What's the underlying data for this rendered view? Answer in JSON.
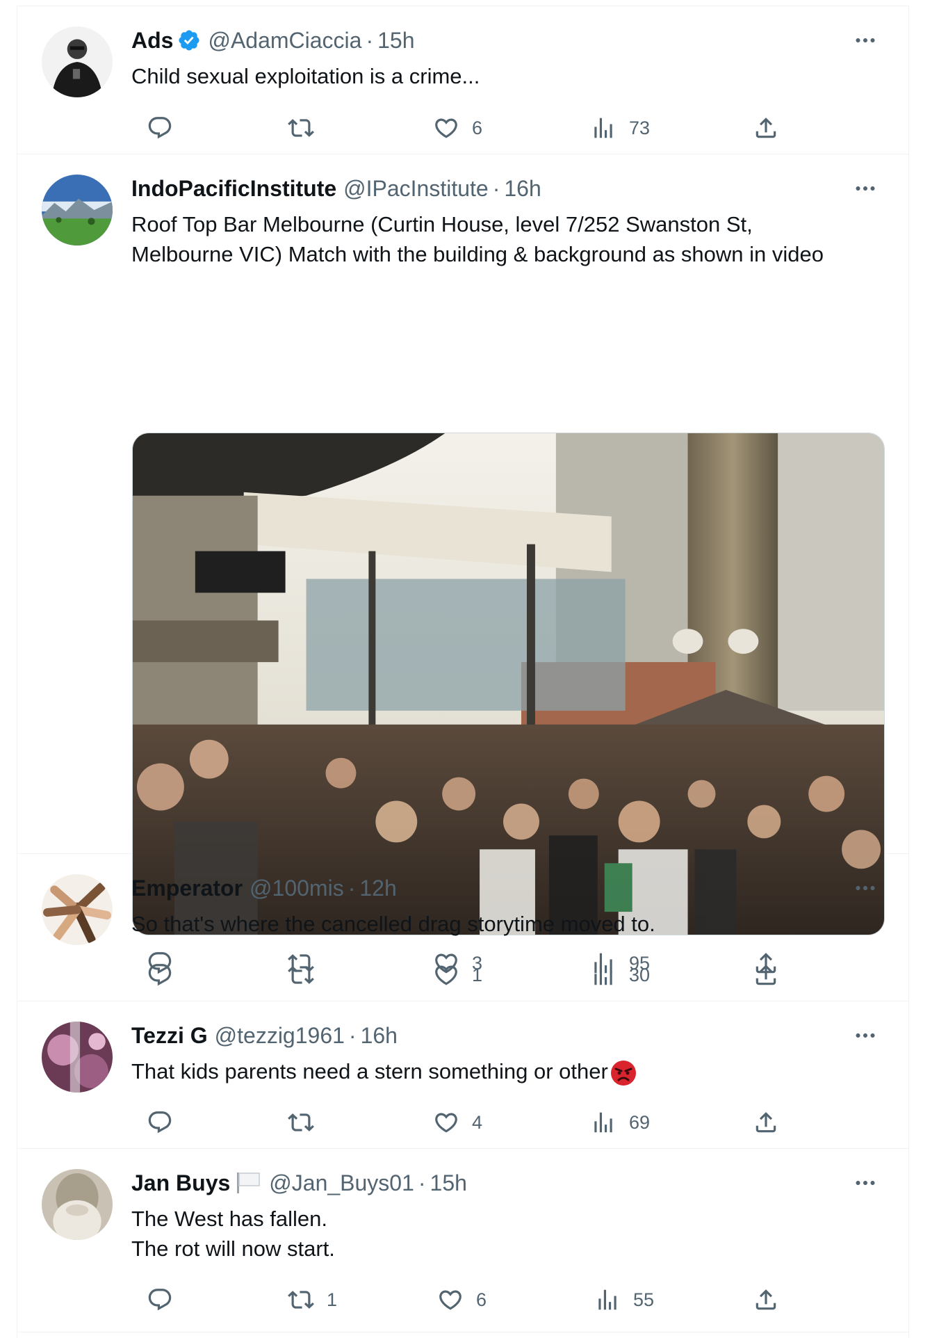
{
  "posts": [
    {
      "name": "Ads",
      "verified": true,
      "handle": "@AdamCiaccia",
      "time": "15h",
      "lines": [
        "Child sexual exploitation is a crime..."
      ],
      "counts": {
        "reply": "",
        "repost": "",
        "like": "6",
        "views": "73"
      }
    },
    {
      "name": "IndoPacificInstitute",
      "handle": "@IPacInstitute",
      "time": "16h",
      "lines": [
        "Roof Top Bar Melbourne (Curtin House, level 7/252 Swanston St,",
        "Melbourne VIC) Match with the building & background as shown in video"
      ],
      "media": "rooftop-bar-crowd-photo",
      "counts": {
        "reply": "",
        "repost": "",
        "like": "3",
        "views": "95"
      }
    },
    {
      "name": "Emperator",
      "handle": "@100mis",
      "time": "12h",
      "lines": [
        "So that's where the cancelled drag storytime moved to."
      ],
      "counts": {
        "reply": "",
        "repost": "",
        "like": "1",
        "views": "30"
      }
    },
    {
      "name": "Tezzi G",
      "handle": "@tezzig1961",
      "time": "16h",
      "lines": [
        "That kids parents need a stern something or other"
      ],
      "emoji": "angry-face-emoji",
      "counts": {
        "reply": "",
        "repost": "",
        "like": "4",
        "views": "69"
      }
    },
    {
      "name": "Jan Buys",
      "flag": "white-flag-emoji",
      "handle": "@Jan_Buys01",
      "time": "15h",
      "lines": [
        "The West has fallen.",
        "The rot will now start."
      ],
      "counts": {
        "reply": "",
        "repost": "1",
        "like": "6",
        "views": "55"
      }
    }
  ],
  "separator": "·",
  "colors": {
    "text": "#0f1419",
    "secondary": "#536471",
    "border": "#eff3f4",
    "verified": "#1d9bf0"
  }
}
